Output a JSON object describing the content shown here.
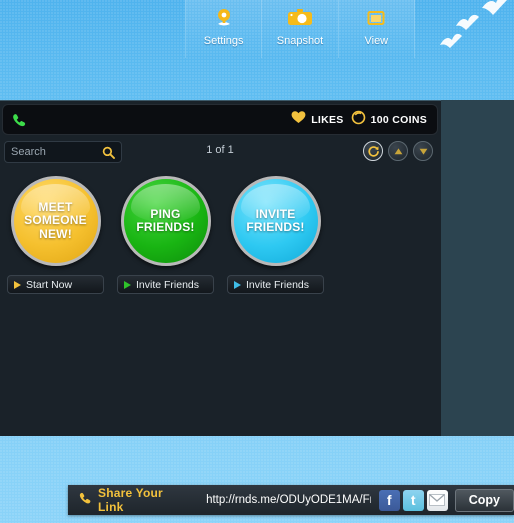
{
  "toolbar": {
    "items": [
      {
        "label": "Settings",
        "icon": "webcam-icon"
      },
      {
        "label": "Snapshot",
        "icon": "camera-icon"
      },
      {
        "label": "View",
        "icon": "window-icon"
      }
    ]
  },
  "header": {
    "phone_icon": "phone-icon",
    "likes": {
      "icon": "heart-icon",
      "label": "LIKES"
    },
    "coins": {
      "icon": "coin-icon",
      "label": "100 COINS"
    }
  },
  "search": {
    "placeholder": "Search",
    "value": "",
    "icon": "search-icon"
  },
  "pagination": {
    "text": "1 of 1",
    "refresh_icon": "refresh-icon",
    "up_icon": "arrow-up-icon",
    "down_icon": "arrow-down-icon"
  },
  "cards": [
    {
      "circle_text": "MEET\nSOMEONE\nNEW!",
      "circle_line1": "MEET",
      "circle_line2": "SOMEONE",
      "circle_line3": "NEW!",
      "button_label": "Start Now",
      "color": "#f5c02e",
      "arrow_color": "#f2c13c"
    },
    {
      "circle_line1": "PING",
      "circle_line2": "FRIENDS!",
      "circle_line3": "",
      "button_label": "Invite Friends",
      "color": "#19b513",
      "arrow_color": "#2fc22a"
    },
    {
      "circle_line1": "INVITE",
      "circle_line2": "FRIENDS!",
      "circle_line3": "",
      "button_label": "Invite Friends",
      "color": "#2ec9f2",
      "arrow_color": "#3fbde8"
    }
  ],
  "share": {
    "label": "Share Your Link",
    "phone_icon": "phone-icon",
    "url": "http://rnds.me/ODUyODE1MA/Fr",
    "facebook_glyph": "f",
    "twitter_glyph": "t",
    "mail_icon": "envelope-icon",
    "copy_label": "Copy"
  },
  "colors": {
    "sky_top": "#4fb3ee",
    "sky_bottom": "#8bd3f8",
    "panel_bg": "#1a2229",
    "panel_right": "#2c4450",
    "header_bg": "#0b0d11",
    "gold": "#f2c13c",
    "green": "#19b513",
    "blue": "#2ec9f2"
  }
}
